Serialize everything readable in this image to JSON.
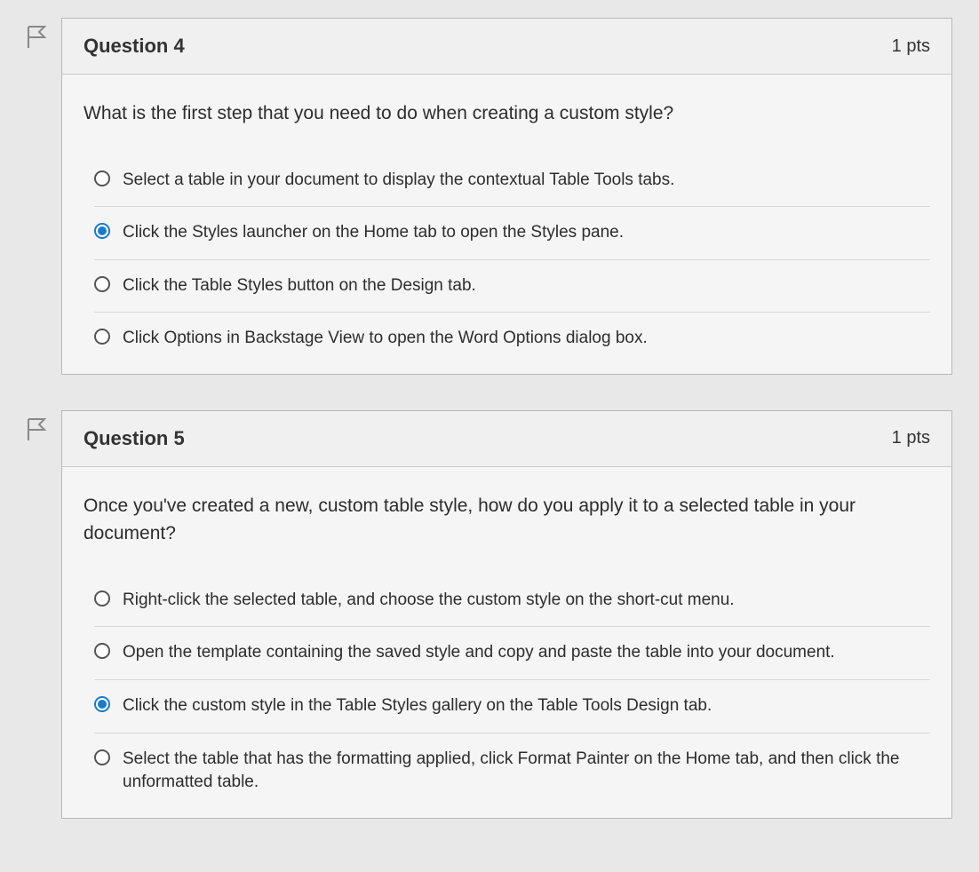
{
  "questions": [
    {
      "title": "Question 4",
      "points": "1 pts",
      "prompt": "What is the first step that you need to do when creating a custom style?",
      "options": [
        {
          "text": "Select a table in your document to display the contextual Table Tools tabs.",
          "selected": false
        },
        {
          "text": "Click the Styles launcher on the Home tab to open the Styles pane.",
          "selected": true
        },
        {
          "text": "Click the Table Styles button on the Design tab.",
          "selected": false
        },
        {
          "text": "Click Options in Backstage View to open the Word Options dialog box.",
          "selected": false
        }
      ]
    },
    {
      "title": "Question 5",
      "points": "1 pts",
      "prompt": "Once you've created a new, custom table style, how do you apply it to a selected table in your document?",
      "options": [
        {
          "text": "Right-click the selected table, and choose the custom style on the short-cut menu.",
          "selected": false
        },
        {
          "text": "Open the template containing the saved style and copy and paste the table into your document.",
          "selected": false
        },
        {
          "text": "Click the custom style in the Table Styles gallery on the Table Tools Design tab.",
          "selected": true
        },
        {
          "text": "Select the table that has the formatting applied, click Format Painter on the Home tab, and then click the unformatted table.",
          "selected": false
        }
      ]
    }
  ]
}
